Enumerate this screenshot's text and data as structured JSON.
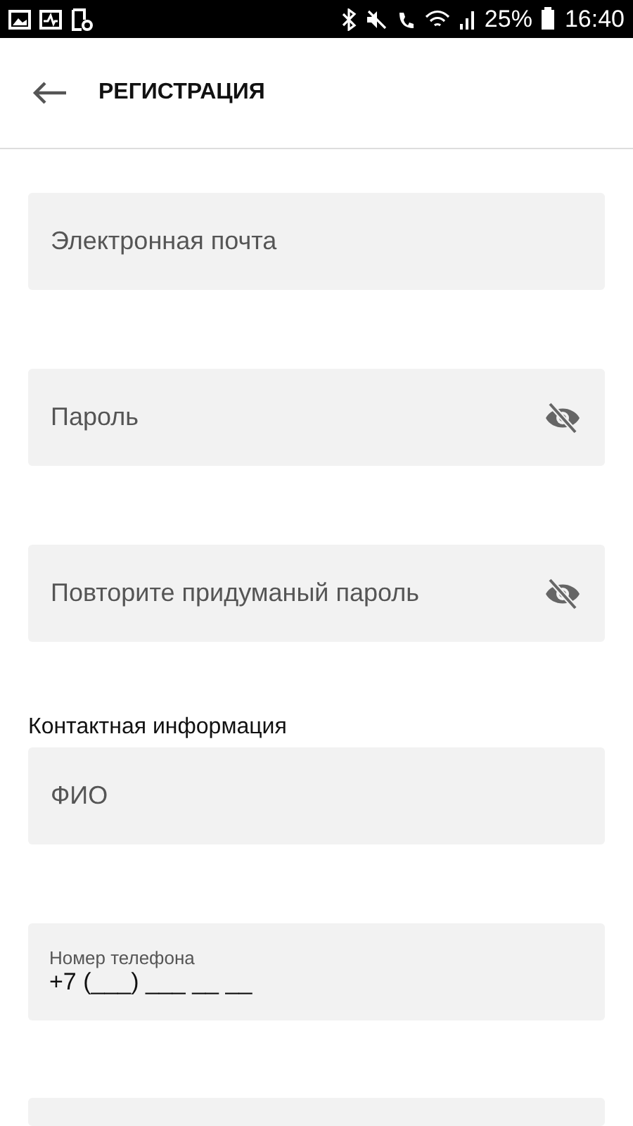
{
  "status_bar": {
    "battery": "25%",
    "time": "16:40"
  },
  "header": {
    "title": "РЕГИСТРАЦИЯ"
  },
  "fields": [
    {
      "kind": "text",
      "placeholder": "Электронная почта"
    },
    {
      "kind": "password",
      "placeholder": "Пароль"
    },
    {
      "kind": "password",
      "placeholder": "Повторите придуманый пароль"
    },
    {
      "kind": "section",
      "label": "Контактная информация"
    },
    {
      "kind": "text",
      "placeholder": "ФИО"
    },
    {
      "kind": "labeled",
      "label": "Номер телефона",
      "value": "+7 (___) ___ __ __"
    }
  ]
}
